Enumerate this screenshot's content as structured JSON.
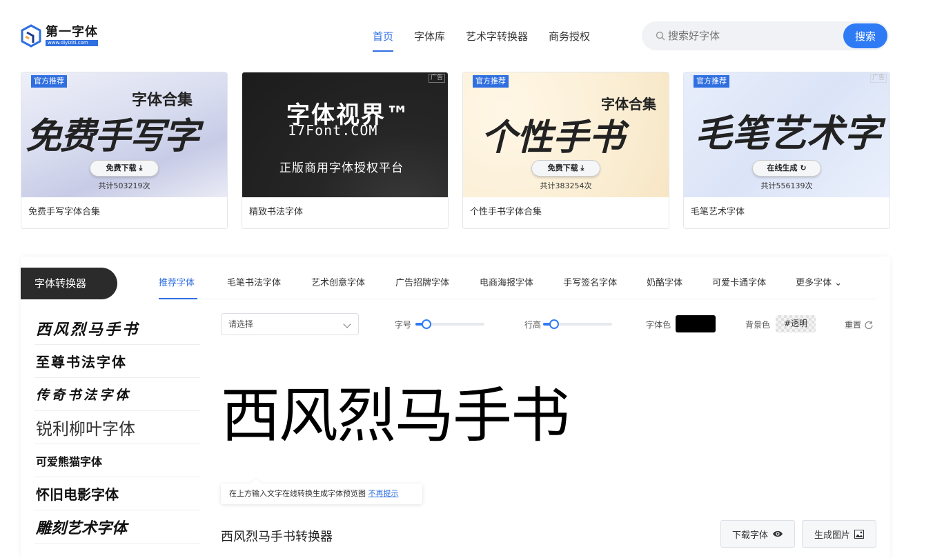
{
  "logo": {
    "title": "第一字体",
    "url": "www.diyiziti.com"
  },
  "nav": [
    {
      "label": "首页"
    },
    {
      "label": "字体库"
    },
    {
      "label": "艺术字转换器"
    },
    {
      "label": "商务授权"
    }
  ],
  "search": {
    "placeholder": "搜索好字体",
    "button": "搜索"
  },
  "banners": [
    {
      "badge": "官方推荐",
      "headline": "免费手写字",
      "subline": "字体合集",
      "button": "免费下载",
      "count": "共计503219次",
      "caption": "免费手写字体合集"
    },
    {
      "ad": "广告",
      "headline": "字体视界™",
      "subline": "17Font.COM",
      "tagline": "正版商用字体授权平台",
      "caption": "精致书法字体"
    },
    {
      "badge": "官方推荐",
      "headline": "个性手书",
      "subline": "字体合集",
      "button": "免费下载",
      "count": "共计383254次",
      "caption": "个性手书字体合集"
    },
    {
      "badge": "官方推荐",
      "ad": "广告",
      "headline": "毛笔艺术字",
      "button": "在线生成",
      "count": "共计556139次",
      "caption": "毛笔艺术字体"
    }
  ],
  "converter": {
    "title": "字体转换器",
    "tabs": [
      "推荐字体",
      "毛笔书法字体",
      "艺术创意字体",
      "广告招牌字体",
      "电商海报字体",
      "手写签名字体",
      "奶酪字体",
      "可爱卡通字体",
      "更多字体"
    ],
    "fonts": [
      "西风烈马手书",
      "至尊书法字体",
      "传奇书法字体",
      "锐利柳叶字体",
      "可爱熊猫字体",
      "怀旧电影字体",
      "雕刻艺术字体"
    ],
    "select_placeholder": "请选择",
    "size_label": "字号",
    "size_level": 0.16,
    "line_label": "行高",
    "line_level": 0.16,
    "color_label": "字体色",
    "font_color": "#000000",
    "bg_label": "背景色",
    "bg_value": "#透明",
    "reset_label": "重置",
    "preview_text": "西风烈马手书",
    "tooltip_text": "在上方输入文字在线转换生成字体预览图",
    "tooltip_link": "不再提示",
    "subtitle": "西风烈马手书转换器",
    "download_btn": "下载字体",
    "image_btn": "生成图片"
  },
  "colors": {
    "accent": "#2f6fe0",
    "dark": "#2b2b2b"
  }
}
